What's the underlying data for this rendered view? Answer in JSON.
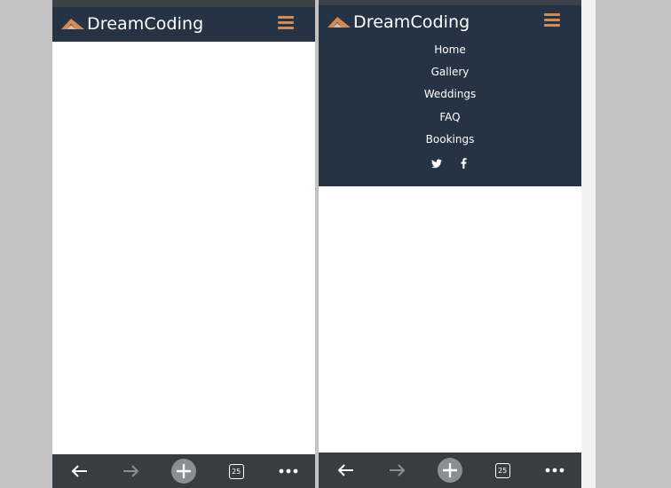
{
  "brand": {
    "name": "DreamCoding",
    "logo_color": "#d08a5a",
    "text_color": "#ffffff"
  },
  "colors": {
    "navbar_bg": "#263345",
    "accent": "#d08a5a",
    "toolbar_bg": "#383d43",
    "page_bg": "#c3c3c3"
  },
  "left_phone": {
    "menu_state": "collapsed"
  },
  "right_phone": {
    "menu_state": "expanded",
    "menu": {
      "items": [
        {
          "label": "Home"
        },
        {
          "label": "Gallery"
        },
        {
          "label": "Weddings"
        },
        {
          "label": "FAQ"
        },
        {
          "label": "Bookings"
        }
      ]
    },
    "socials": [
      "twitter-icon",
      "facebook-icon"
    ]
  },
  "toolbar": {
    "icons": [
      "back-arrow-icon",
      "forward-arrow-icon",
      "new-tab-plus-icon",
      "tabs-count-icon",
      "more-dots-icon"
    ],
    "tabs_count": "25"
  }
}
